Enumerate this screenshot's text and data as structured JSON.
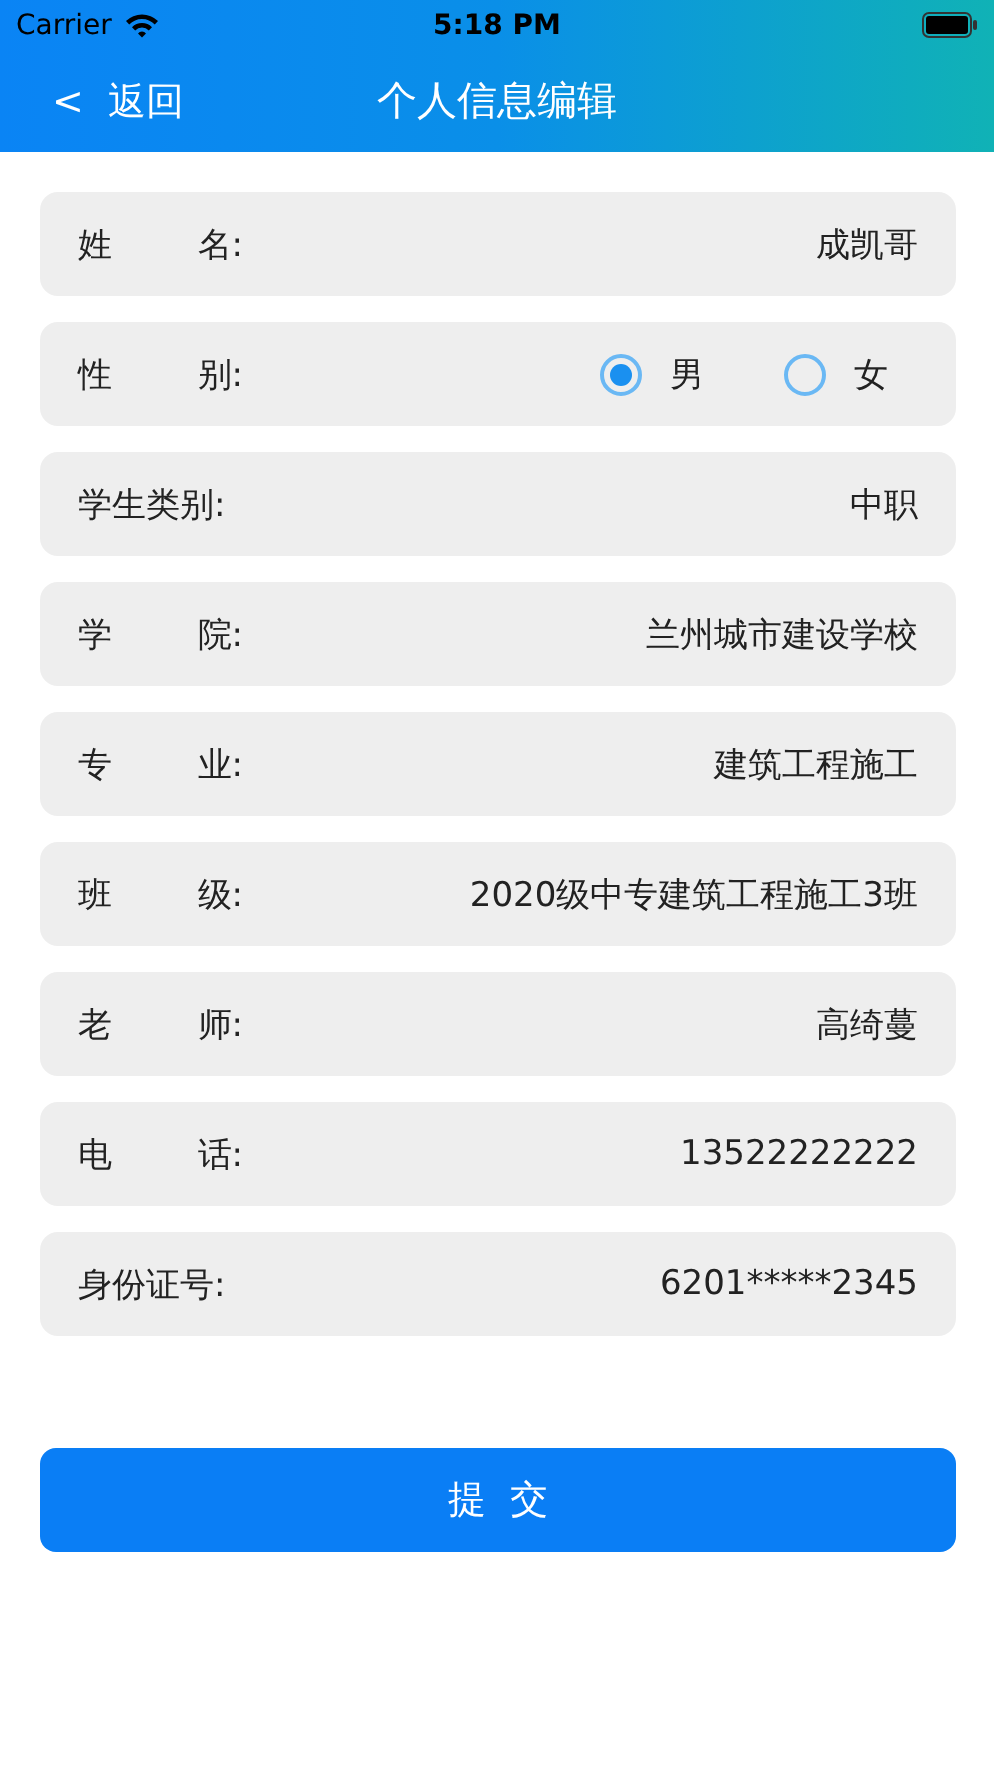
{
  "status_bar": {
    "carrier": "Carrier",
    "time": "5:18 PM"
  },
  "nav": {
    "back": "<  返回",
    "title": "个人信息编辑"
  },
  "fields": [
    {
      "kind": "text",
      "label": "姓 名:",
      "value": "成凯哥"
    },
    {
      "kind": "radio",
      "label": "性 别:",
      "options": [
        {
          "label": "男",
          "selected": true
        },
        {
          "label": "女",
          "selected": false
        }
      ]
    },
    {
      "kind": "text",
      "label": "学生类别:",
      "value": "中职"
    },
    {
      "kind": "text",
      "label": "学 院:",
      "value": "兰州城市建设学校"
    },
    {
      "kind": "text",
      "label": "专 业:",
      "value": "建筑工程施工"
    },
    {
      "kind": "text",
      "label": "班 级:",
      "value": "2020级中专建筑工程施工3班"
    },
    {
      "kind": "text",
      "label": "老 师:",
      "value": "高绮蔓"
    },
    {
      "kind": "text",
      "label": "电 话:",
      "value": "13522222222"
    },
    {
      "kind": "text",
      "label": "身份证号:",
      "value": "6201*****2345"
    }
  ],
  "submit": "提 交"
}
